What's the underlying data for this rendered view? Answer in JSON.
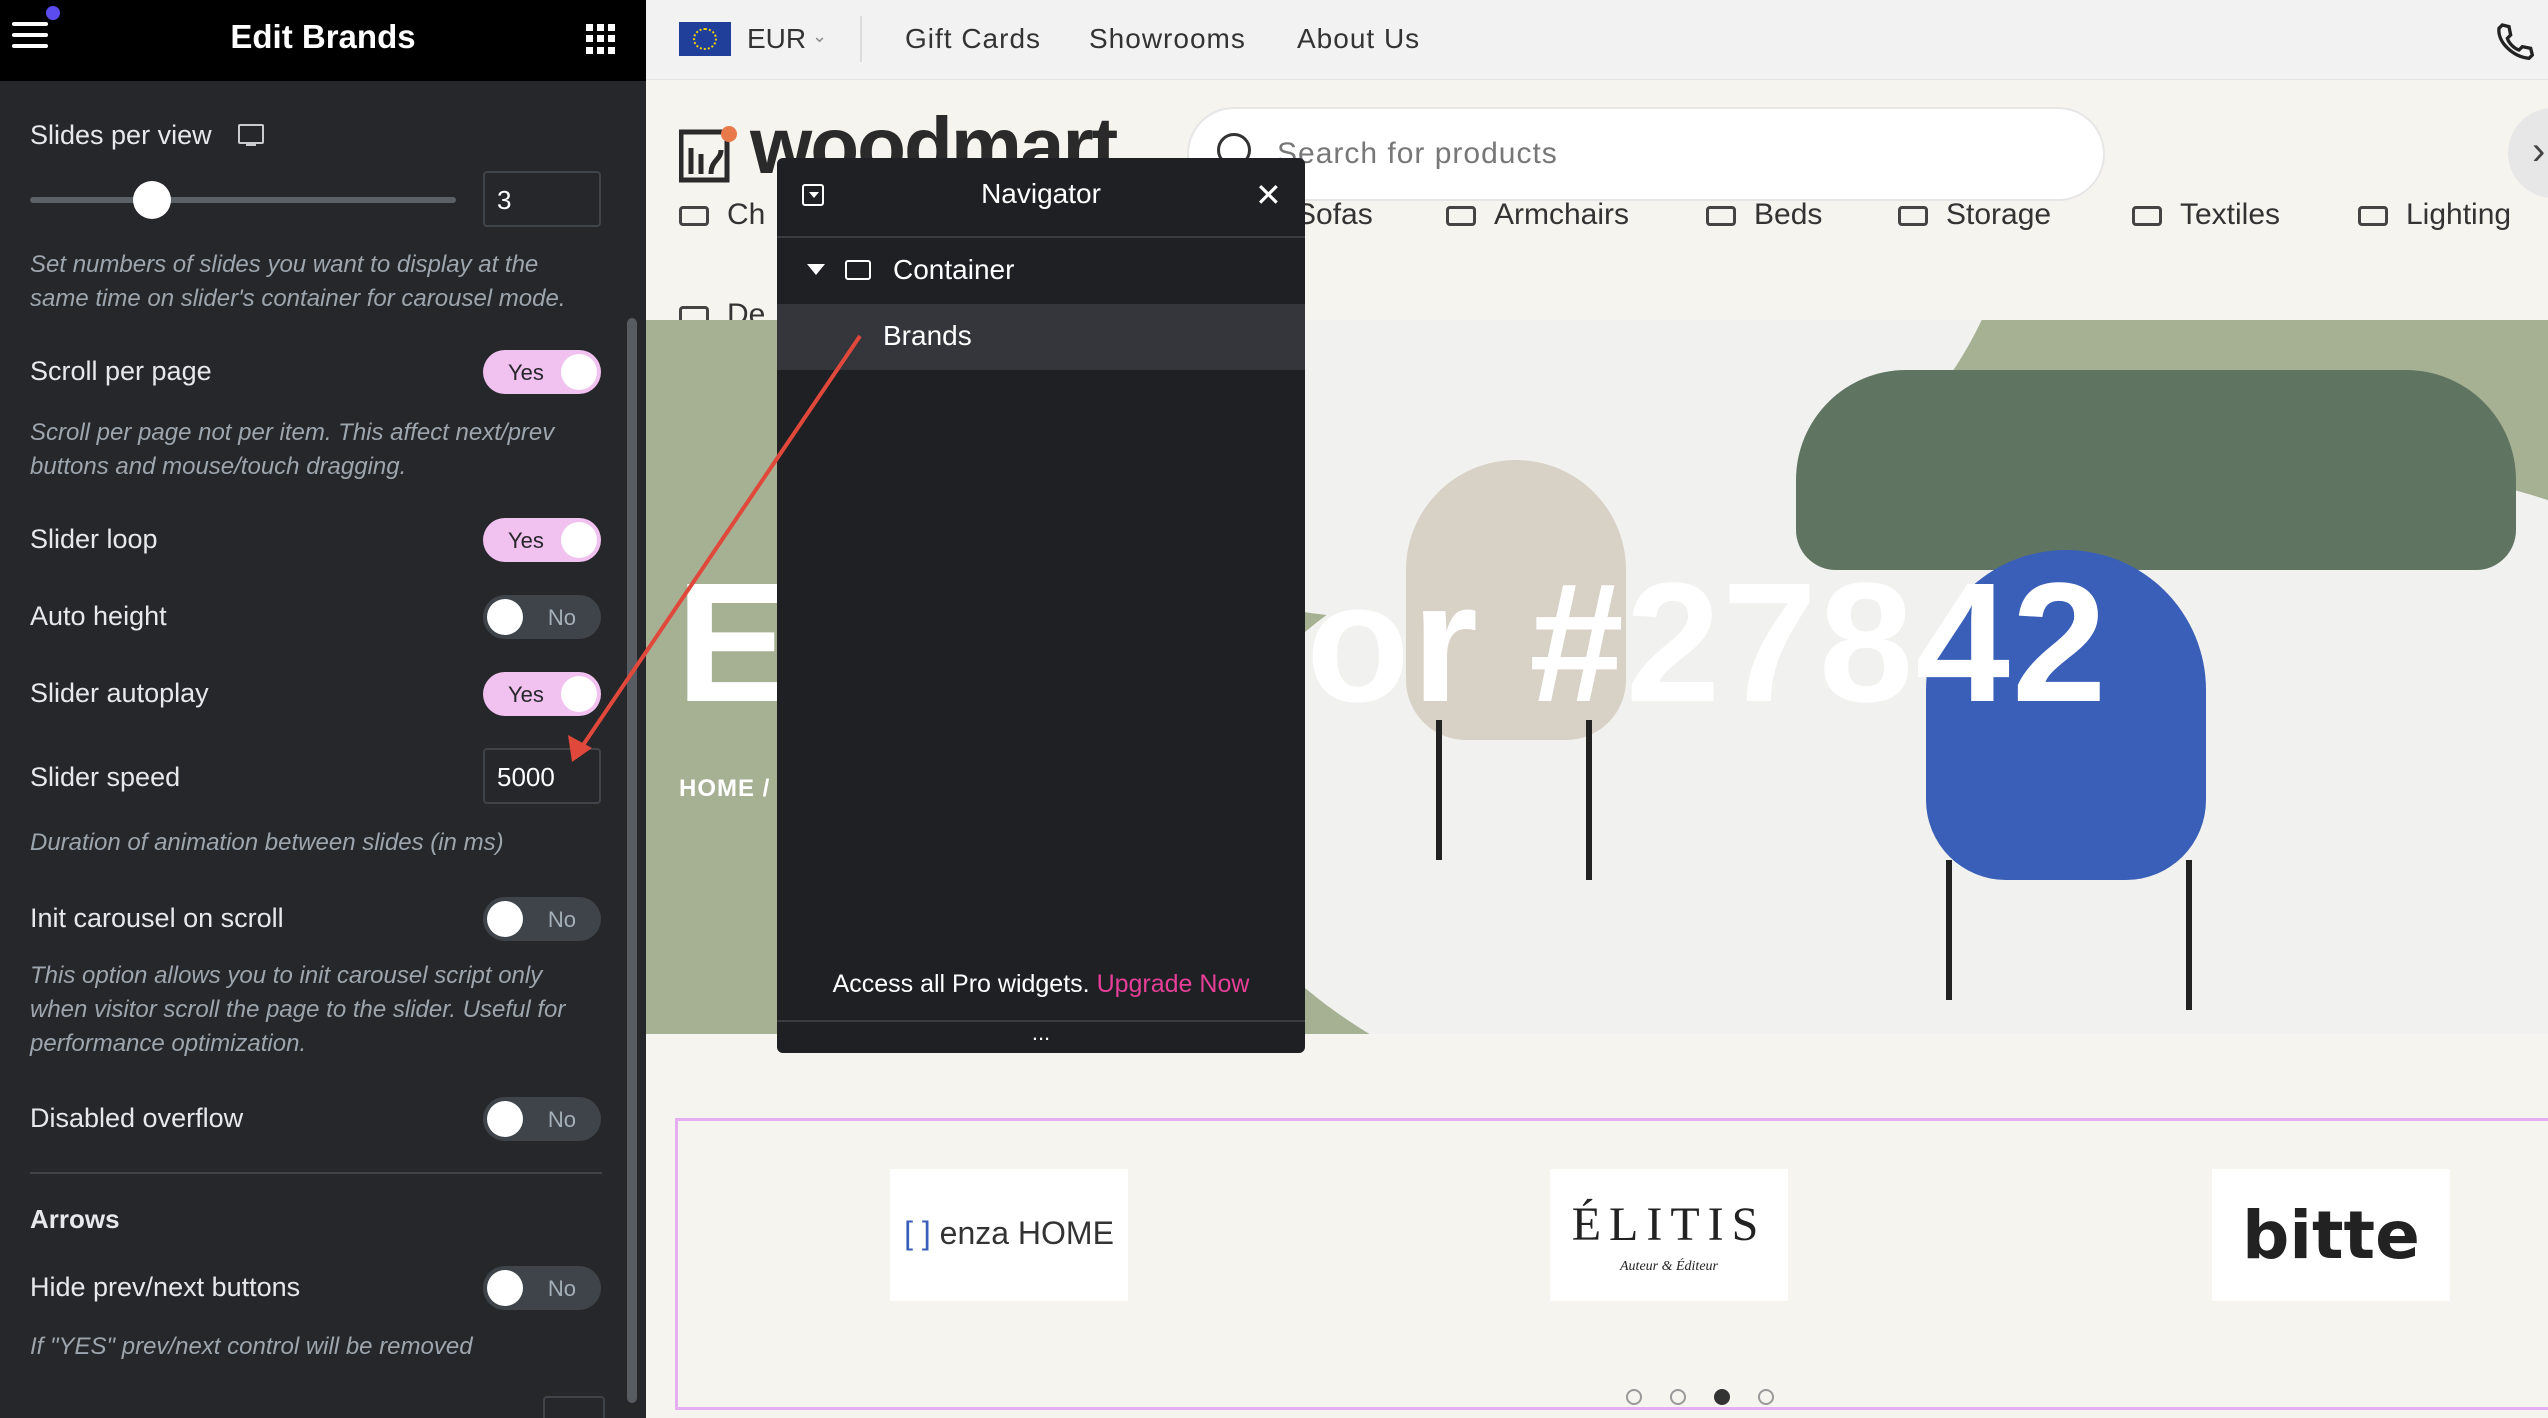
{
  "panel": {
    "title": "Edit Brands",
    "slides_per_view": {
      "label": "Slides per view",
      "value": "3",
      "slider_level": 0.2,
      "desc": "Set numbers of slides you want to display at the same time on slider's container for carousel mode."
    },
    "scroll_per_page": {
      "label": "Scroll per page",
      "state": "Yes",
      "desc": "Scroll per page not per item. This affect next/prev buttons and mouse/touch dragging."
    },
    "slider_loop": {
      "label": "Slider loop",
      "state": "Yes"
    },
    "auto_height": {
      "label": "Auto height",
      "state": "No"
    },
    "slider_autoplay": {
      "label": "Slider autoplay",
      "state": "Yes"
    },
    "slider_speed": {
      "label": "Slider speed",
      "value": "5000",
      "desc": "Duration of animation between slides (in ms)"
    },
    "init_carousel": {
      "label": "Init carousel on scroll",
      "state": "No",
      "desc": "This option allows you to init carousel script only when visitor scroll the page to the slider. Useful for performance optimization."
    },
    "disabled_overflow": {
      "label": "Disabled overflow",
      "state": "No"
    },
    "arrows_section": "Arrows",
    "hide_buttons": {
      "label": "Hide prev/next buttons",
      "state": "No",
      "desc": "If \"YES\" prev/next control will be removed"
    },
    "accent_color": "#f1c1f0"
  },
  "site": {
    "currency": "EUR",
    "top_links": [
      "Gift Cards",
      "Showrooms",
      "About Us"
    ],
    "logo_text": "woodmart",
    "search_placeholder": "Search for products",
    "categories": [
      "Ch",
      "Sofas",
      "Armchairs",
      "Beds",
      "Storage",
      "Textiles",
      "Lighting",
      "De"
    ],
    "hero_title_left": "E",
    "hero_title_right": "or #27842",
    "breadcrumb": "HOME  /",
    "brands": [
      {
        "name": "enza HOME",
        "icon": "bracket-icon"
      },
      {
        "name": "ÉLITIS",
        "sub": "Auteur & Éditeur"
      },
      {
        "name": "bitte"
      }
    ],
    "dots_active": 3
  },
  "navigator": {
    "title": "Navigator",
    "tree": {
      "container": "Container",
      "child": "Brands"
    },
    "footer_text": "Access all Pro widgets.",
    "upgrade": "Upgrade Now",
    "more": "..."
  }
}
